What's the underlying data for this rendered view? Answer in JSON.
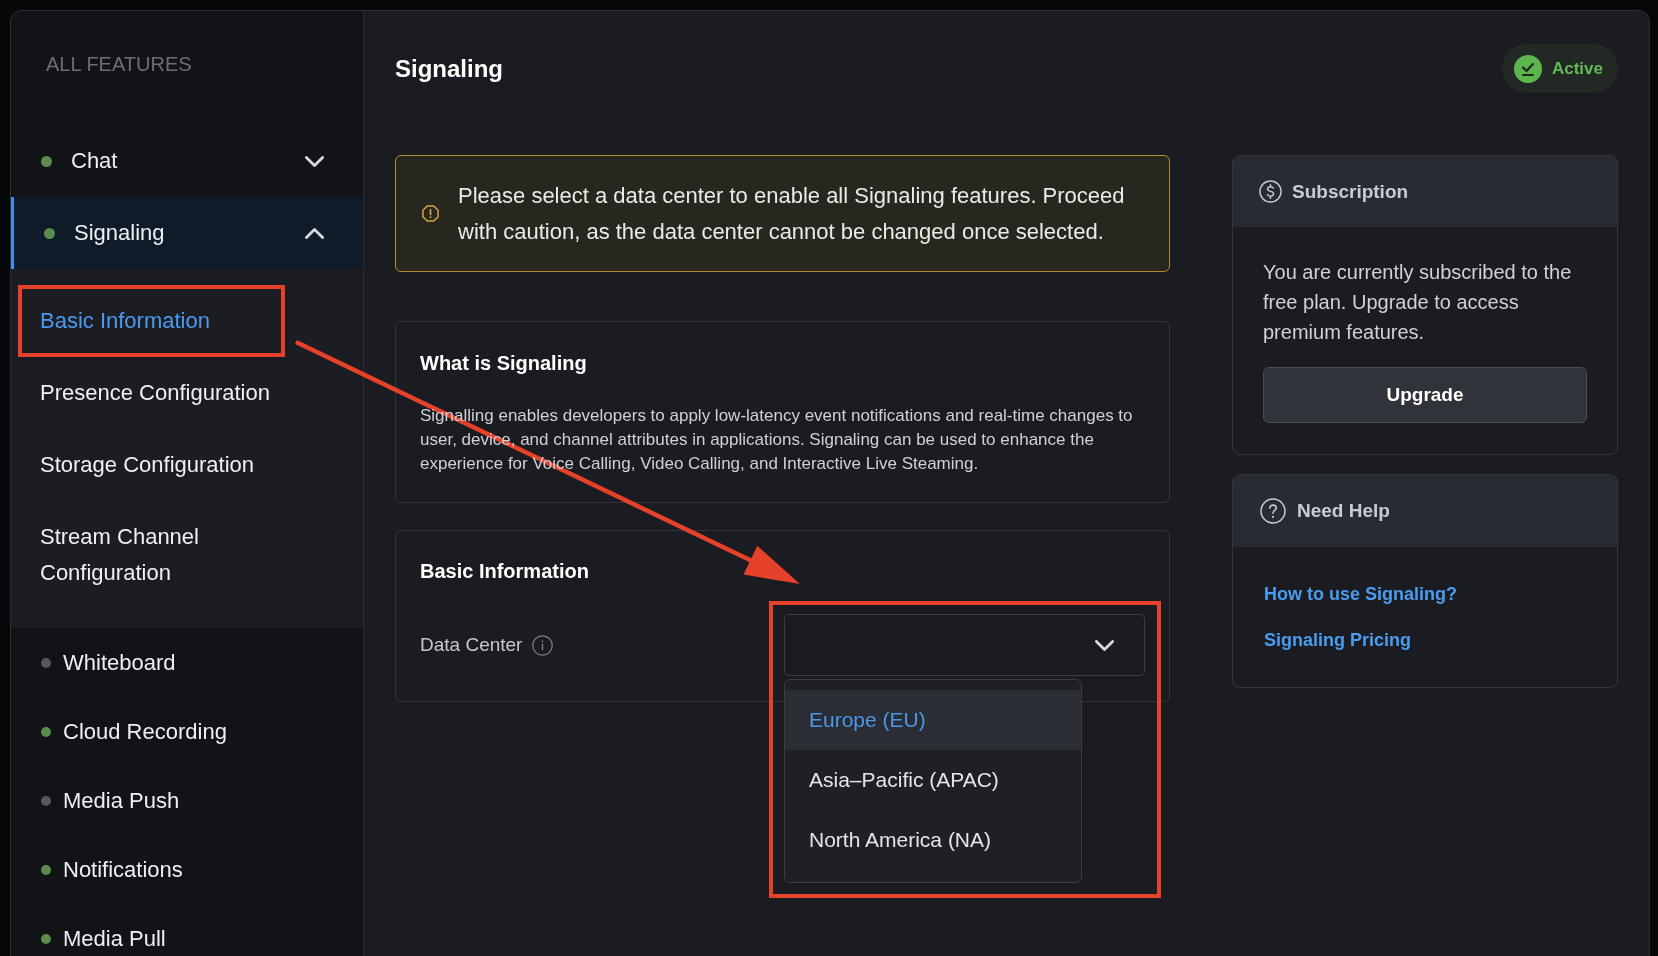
{
  "sidebar": {
    "heading": "ALL FEATURES",
    "items": [
      {
        "label": "Chat",
        "color": "#5b8c4c",
        "selected": false,
        "expanded": false
      },
      {
        "label": "Signaling",
        "color": "#5b8c4c",
        "selected": true,
        "expanded": true,
        "children": [
          {
            "label": "Basic Information",
            "selected": true,
            "highlighted": true
          },
          {
            "label": "Presence Configuration",
            "selected": false,
            "highlighted": false
          },
          {
            "label": "Storage Configuration",
            "selected": false,
            "highlighted": false
          },
          {
            "label": "Stream Channel Configuration",
            "selected": false,
            "highlighted": false
          }
        ]
      },
      {
        "label": "Whiteboard",
        "color": "#56585e",
        "selected": false
      },
      {
        "label": "Cloud Recording",
        "color": "#5b8c4c",
        "selected": false
      },
      {
        "label": "Media Push",
        "color": "#56585e",
        "selected": false
      },
      {
        "label": "Notifications",
        "color": "#5b8c4c",
        "selected": false
      },
      {
        "label": "Media Pull",
        "color": "#5b8c4c",
        "selected": false
      }
    ]
  },
  "header": {
    "title": "Signaling",
    "status": "Active"
  },
  "alert": {
    "text": "Please select a data center to enable all Signaling features. Proceed with caution, as the data center cannot be changed once selected."
  },
  "about": {
    "title": "What is Signaling",
    "text": "Signalling enables developers to apply low-latency event notifications and real-time changes to user, device, and channel attributes in applications. Signaling can be used to enhance the experience for Voice Calling, Video Calling, and Interactive Live Steaming."
  },
  "basic_information": {
    "title": "Basic Information",
    "fields": [
      {
        "kind": "select",
        "label": "Data Center",
        "expanded": true,
        "highlighted": true,
        "options": [
          {
            "label": "Europe (EU)",
            "selected": true
          },
          {
            "label": "Asia–Pacific (APAC)",
            "selected": false
          },
          {
            "label": "North America (NA)",
            "selected": false
          }
        ]
      }
    ]
  },
  "subscription": {
    "title": "Subscription",
    "text": "You are currently subscribed to the free plan. Upgrade to access premium features.",
    "button": "Upgrade"
  },
  "help": {
    "title": "Need Help",
    "links": [
      "How to use Signaling?",
      "Signaling Pricing"
    ]
  },
  "annotation": {
    "arrow": true
  }
}
